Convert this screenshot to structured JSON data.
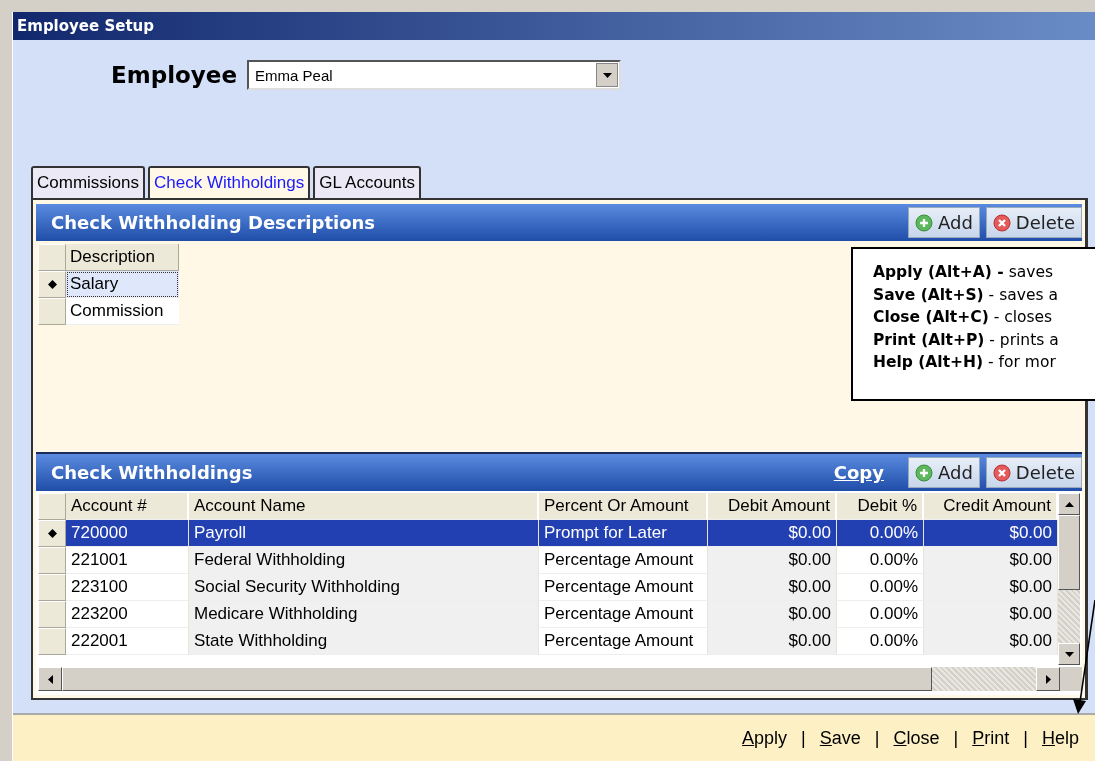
{
  "window": {
    "title": "Employee Setup"
  },
  "employee": {
    "label": "Employee",
    "value": "Emma Peal"
  },
  "tabs": [
    {
      "label": "Commissions",
      "selected": false
    },
    {
      "label": "Check Withholdings",
      "selected": true
    },
    {
      "label": "GL Accounts",
      "selected": false
    }
  ],
  "descriptions": {
    "title": "Check Withholding Descriptions",
    "buttons": [
      {
        "kind": "add",
        "label": "Add"
      },
      {
        "kind": "delete",
        "label": "Delete"
      }
    ],
    "column": "Description",
    "rows": [
      {
        "description": "Salary",
        "selected": true
      },
      {
        "description": "Commission",
        "selected": false
      }
    ]
  },
  "callout": {
    "lines": [
      "**Apply (Alt+A) -** saves",
      "**Save (Alt+S)** - saves a",
      "**Close (Alt+C)** - closes",
      "**Print (Alt+P)** - prints a",
      "**Help (Alt+H)** - for mor"
    ]
  },
  "withholdings": {
    "title": "Check Withholdings",
    "link": "Copy",
    "buttons": [
      {
        "kind": "add",
        "label": "Add"
      },
      {
        "kind": "delete",
        "label": "Delete"
      }
    ],
    "columns": [
      "Account #",
      "Account Name",
      "Percent Or Amount",
      "Debit Amount",
      "Debit %",
      "Credit Amount"
    ],
    "rows": [
      {
        "cells": [
          "720000",
          "Payroll",
          "Prompt for Later",
          "$0.00",
          "0.00%",
          "$0.00"
        ],
        "selected": true
      },
      {
        "cells": [
          "221001",
          "Federal Withholding",
          "Percentage Amount",
          "$0.00",
          "0.00%",
          "$0.00"
        ],
        "selected": false
      },
      {
        "cells": [
          "223100",
          "Social Security Withholding",
          "Percentage Amount",
          "$0.00",
          "0.00%",
          "$0.00"
        ],
        "selected": false
      },
      {
        "cells": [
          "223200",
          "Medicare Withholding",
          "Percentage Amount",
          "$0.00",
          "0.00%",
          "$0.00"
        ],
        "selected": false
      },
      {
        "cells": [
          "222001",
          "State Withholding",
          "Percentage Amount",
          "$0.00",
          "0.00%",
          "$0.00"
        ],
        "selected": false
      }
    ]
  },
  "footer": {
    "actions": [
      "Apply",
      "Save",
      "Close",
      "Print",
      "Help"
    ],
    "separator": "|"
  }
}
